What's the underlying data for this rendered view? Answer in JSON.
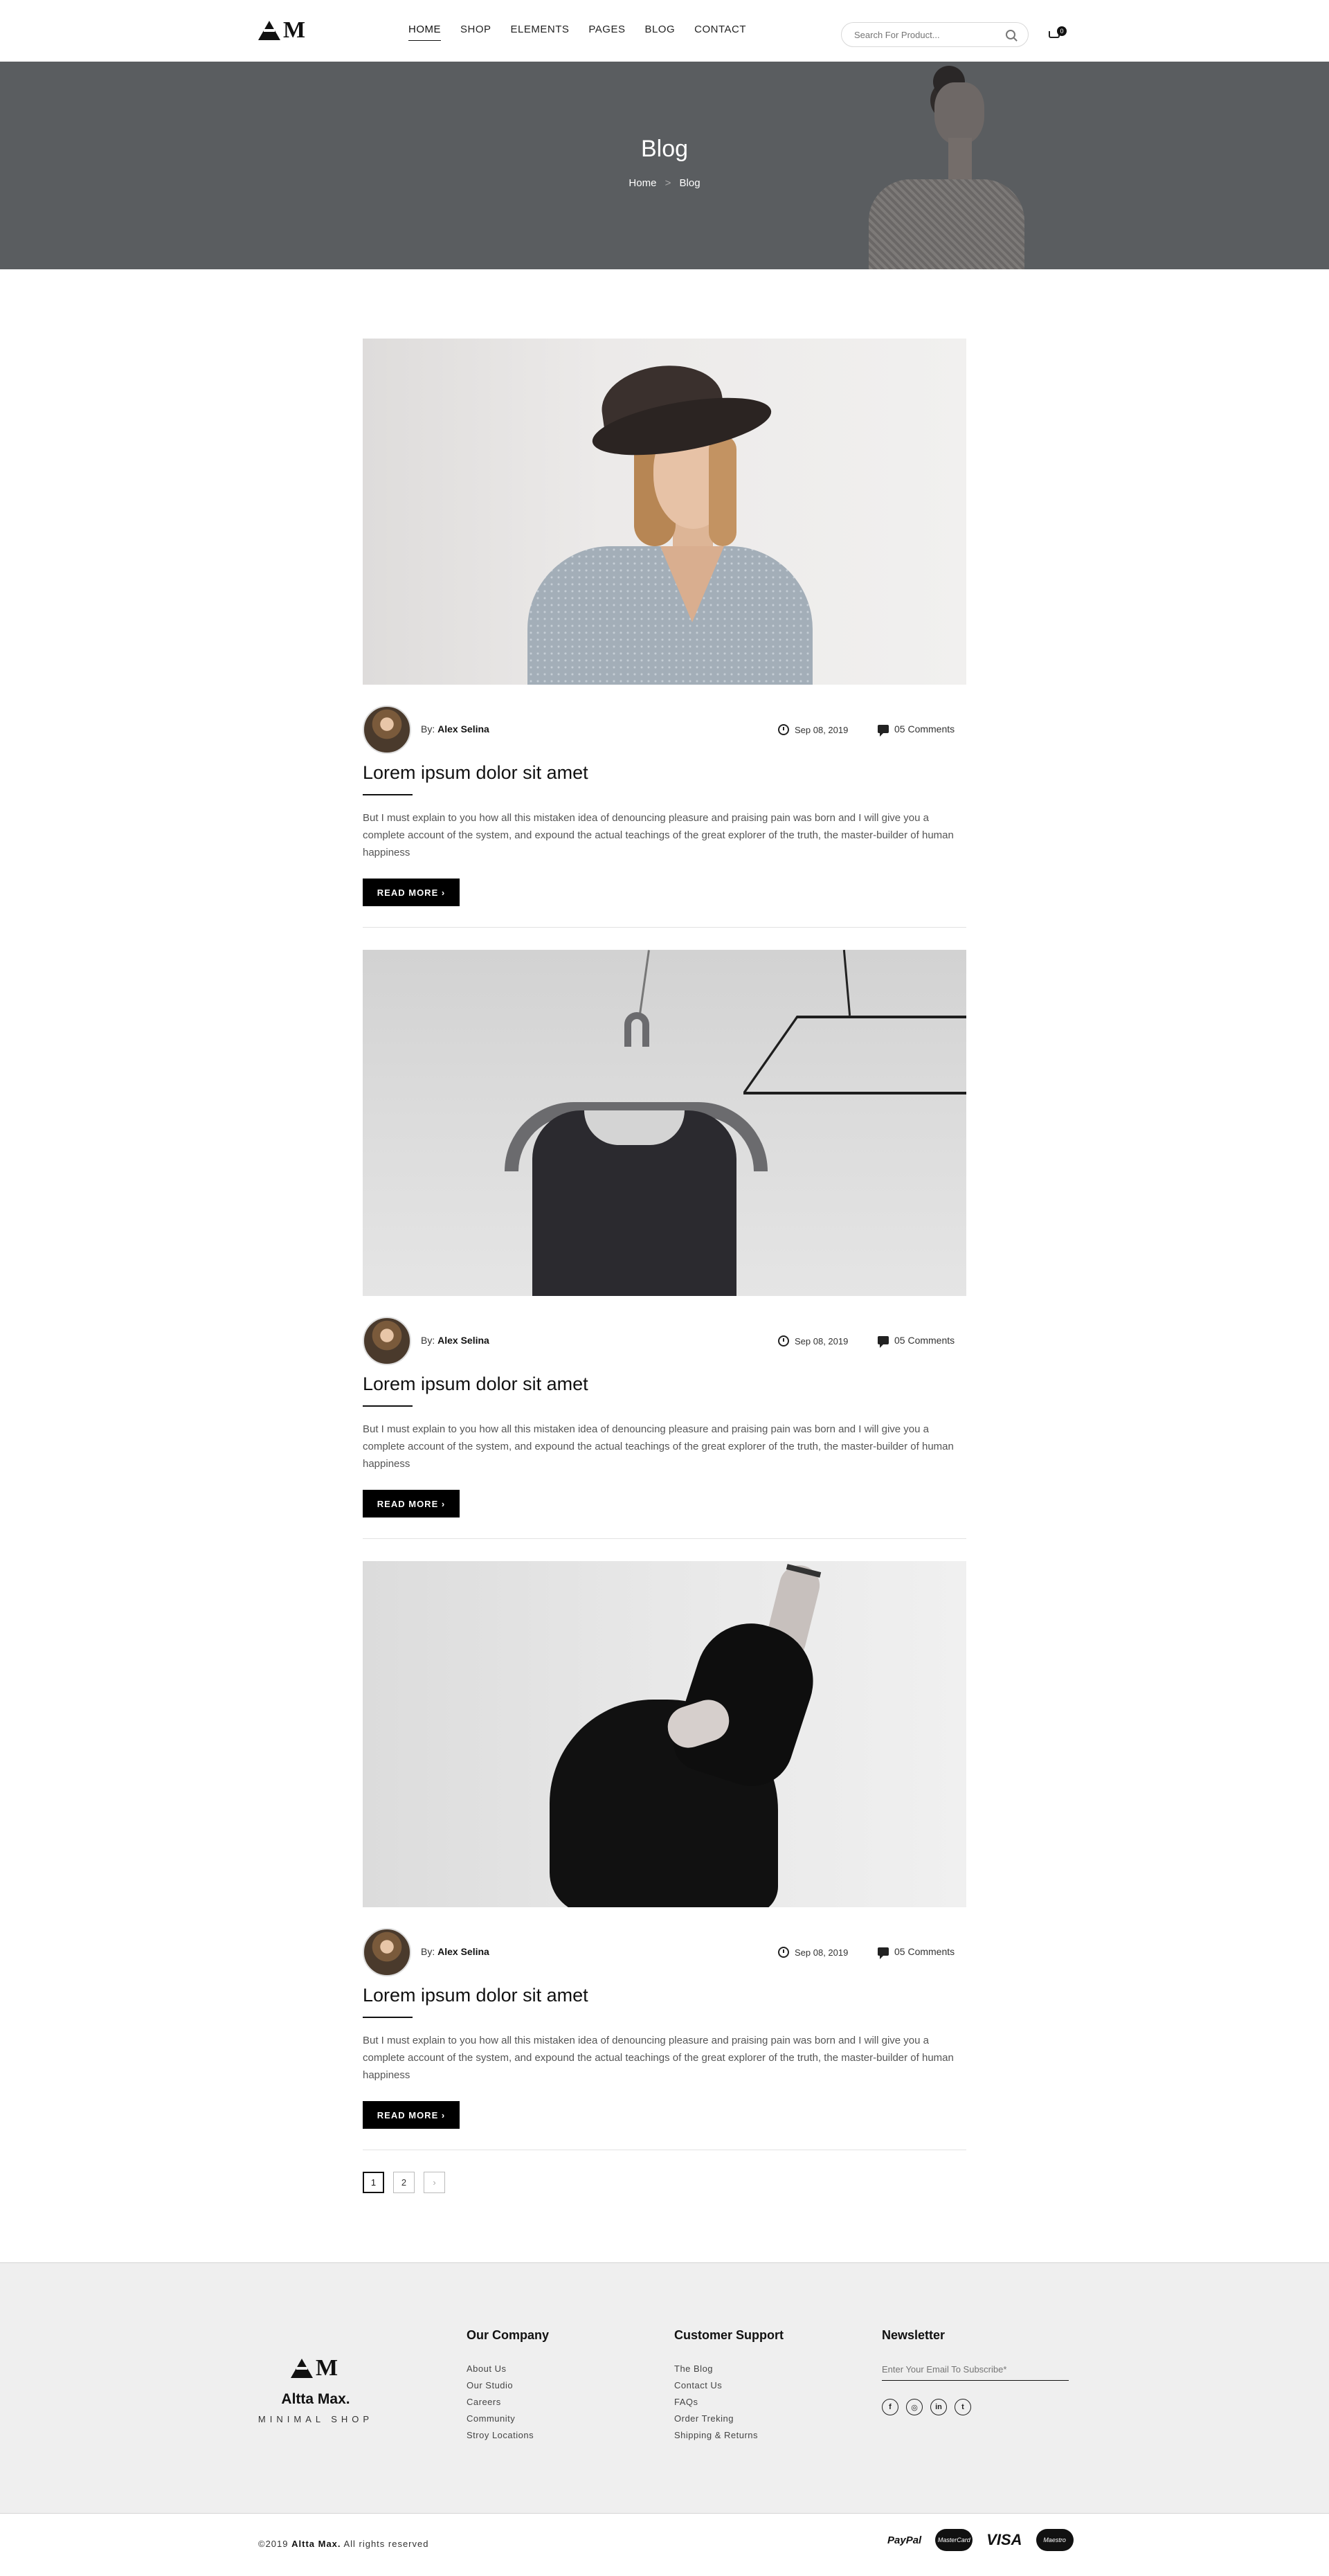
{
  "header": {
    "logo_letter": "M",
    "nav": [
      {
        "label": "HOME",
        "active": true
      },
      {
        "label": "SHOP",
        "active": false
      },
      {
        "label": "ELEMENTS",
        "active": false
      },
      {
        "label": "PAGES",
        "active": false
      },
      {
        "label": "BLOG",
        "active": false
      },
      {
        "label": "CONTACT",
        "active": false
      }
    ],
    "search_placeholder": "Search For Product...",
    "cart_count": "0"
  },
  "hero": {
    "title": "Blog",
    "breadcrumb": [
      "Home",
      ">",
      "Blog"
    ]
  },
  "posts": [
    {
      "author_prefix": "By:",
      "author": "Alex Selina",
      "date": "Sep 08, 2019",
      "comments": "05 Comments",
      "title": "Lorem ipsum dolor sit amet",
      "excerpt": "But I must explain to you how all this mistaken idea of denouncing pleasure and praising pain was born and I will give you a complete account of the system, and expound the actual teachings of the great explorer of the truth, the master-builder of human happiness",
      "read_more": "READ MORE ›"
    },
    {
      "author_prefix": "By:",
      "author": "Alex Selina",
      "date": "Sep 08, 2019",
      "comments": "05 Comments",
      "title": "Lorem ipsum dolor sit amet",
      "excerpt": "But I must explain to you how all this mistaken idea of denouncing pleasure and praising pain was born and I will give you a complete account of the system, and expound the actual teachings of the great explorer of the truth, the master-builder of human happiness",
      "read_more": "READ MORE ›"
    },
    {
      "author_prefix": "By:",
      "author": "Alex Selina",
      "date": "Sep 08, 2019",
      "comments": "05 Comments",
      "title": "Lorem ipsum dolor sit amet",
      "excerpt": "But I must explain to you how all this mistaken idea of denouncing pleasure and praising pain was born and I will give you a complete account of the system, and expound the actual teachings of the great explorer of the truth, the master-builder of human happiness",
      "read_more": "READ MORE ›"
    }
  ],
  "pagination": [
    "1",
    "2",
    "›"
  ],
  "footer": {
    "logo_letter": "M",
    "brand": "Altta Max.",
    "tagline": "MINIMAL SHOP",
    "company": {
      "heading": "Our Company",
      "links": [
        "About Us",
        "Our Studio",
        "Careers",
        "Community",
        "Stroy Locations"
      ]
    },
    "support": {
      "heading": "Customer Support",
      "links": [
        "The Blog",
        "Contact Us",
        "FAQs",
        "Order Treking",
        "Shipping & Returns"
      ]
    },
    "newsletter": {
      "heading": "Newsletter",
      "placeholder": "Enter Your Email To Subscribe*"
    },
    "socials": [
      "f",
      "◎",
      "in",
      "t"
    ]
  },
  "bottom": {
    "copyright_prefix": "©2019",
    "copyright_brand": "Altta Max.",
    "copyright_suffix": "All rights reserved",
    "payments": [
      "PayPal",
      "MasterCard",
      "VISA",
      "Maestro"
    ]
  },
  "colors": {
    "hero_bg": "#5a5d60",
    "button_bg": "#000000",
    "footer_bg": "#efefef"
  }
}
